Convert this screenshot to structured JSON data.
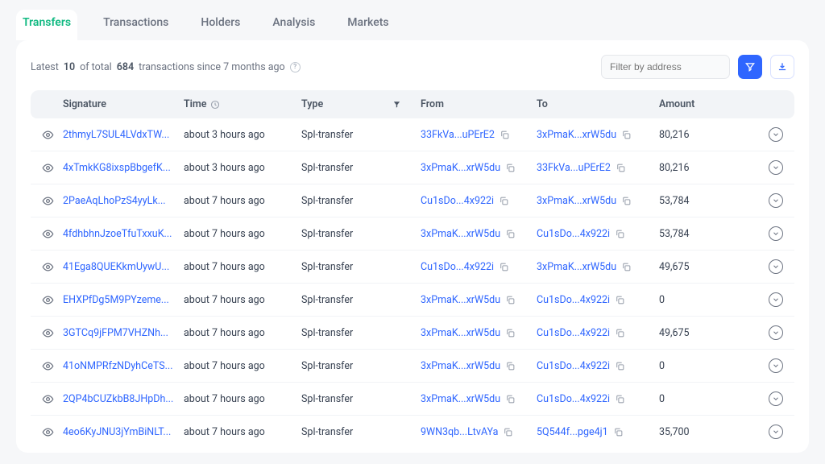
{
  "tabs": [
    "Transfers",
    "Transactions",
    "Holders",
    "Analysis",
    "Markets"
  ],
  "activeTab": 0,
  "summary": {
    "prefix": "Latest",
    "count": "10",
    "mid": "of total",
    "total": "684",
    "suffix": "transactions since 7 months ago"
  },
  "filter": {
    "placeholder": "Filter by address"
  },
  "columns": {
    "signature": "Signature",
    "time": "Time",
    "type": "Type",
    "from": "From",
    "to": "To",
    "amount": "Amount"
  },
  "rows": [
    {
      "signature": "2thmyL7SUL4LVdxTW...",
      "time": "about 3 hours ago",
      "type": "Spl-transfer",
      "from": "33FkVa...uPErE2",
      "to": "3xPmaK...xrW5du",
      "amount": "80,216"
    },
    {
      "signature": "4xTmkKG8ixspBbgefK...",
      "time": "about 3 hours ago",
      "type": "Spl-transfer",
      "from": "3xPmaK...xrW5du",
      "to": "33FkVa...uPErE2",
      "amount": "80,216"
    },
    {
      "signature": "2PaeAqLhoPzS4yyLk...",
      "time": "about 7 hours ago",
      "type": "Spl-transfer",
      "from": "Cu1sDo...4x922i",
      "to": "3xPmaK...xrW5du",
      "amount": "53,784"
    },
    {
      "signature": "4fdhbhnJzoeTfuTxxuK...",
      "time": "about 7 hours ago",
      "type": "Spl-transfer",
      "from": "3xPmaK...xrW5du",
      "to": "Cu1sDo...4x922i",
      "amount": "53,784"
    },
    {
      "signature": "41Ega8QUEKkmUywU...",
      "time": "about 7 hours ago",
      "type": "Spl-transfer",
      "from": "Cu1sDo...4x922i",
      "to": "3xPmaK...xrW5du",
      "amount": "49,675"
    },
    {
      "signature": "EHXPfDg5M9PYzeme...",
      "time": "about 7 hours ago",
      "type": "Spl-transfer",
      "from": "3xPmaK...xrW5du",
      "to": "Cu1sDo...4x922i",
      "amount": "0"
    },
    {
      "signature": "3GTCq9jFPM7VHZNh...",
      "time": "about 7 hours ago",
      "type": "Spl-transfer",
      "from": "3xPmaK...xrW5du",
      "to": "Cu1sDo...4x922i",
      "amount": "49,675"
    },
    {
      "signature": "41oNMPRfzNDyhCeTS...",
      "time": "about 7 hours ago",
      "type": "Spl-transfer",
      "from": "3xPmaK...xrW5du",
      "to": "Cu1sDo...4x922i",
      "amount": "0"
    },
    {
      "signature": "2QP4bCUZkbB8JHpDh...",
      "time": "about 7 hours ago",
      "type": "Spl-transfer",
      "from": "3xPmaK...xrW5du",
      "to": "Cu1sDo...4x922i",
      "amount": "0"
    },
    {
      "signature": "4eo6KyJNU3jYmBiNLT...",
      "time": "about 7 hours ago",
      "type": "Spl-transfer",
      "from": "9WN3qb...LtvAYa",
      "to": "5Q544f...pge4j1",
      "amount": "35,700"
    }
  ]
}
